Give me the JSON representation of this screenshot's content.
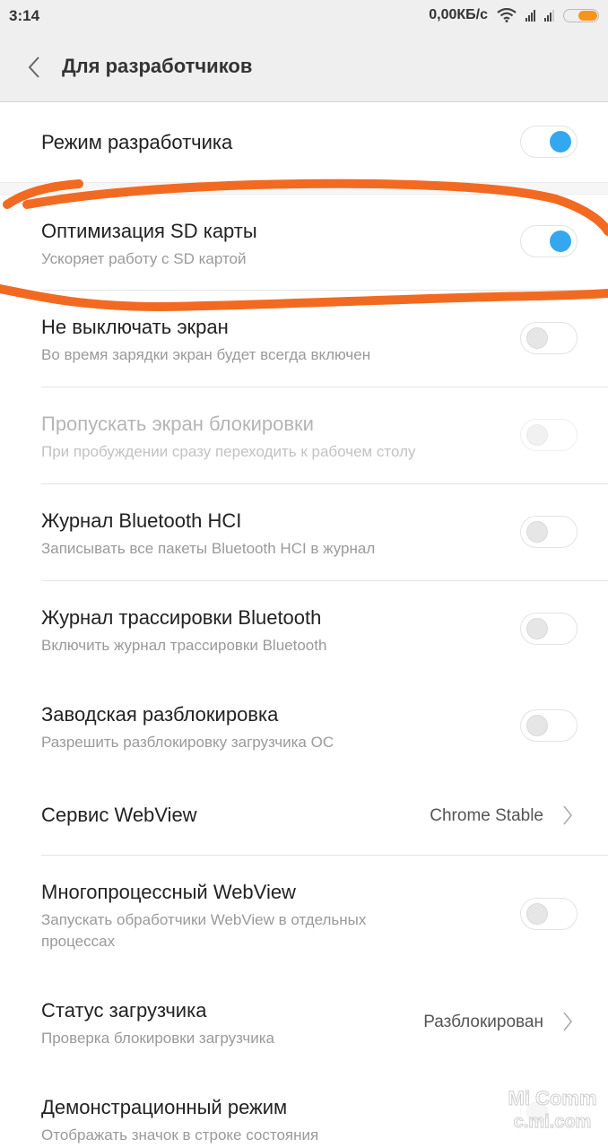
{
  "status_bar": {
    "time": "3:14",
    "net_speed": "0,00КБ/с",
    "wifi_icon": "wifi-icon",
    "signal_icons": [
      "signal-sim1-icon",
      "signal-sim2-icon"
    ],
    "battery_percent": 60,
    "battery_color": "#f7941d"
  },
  "header": {
    "back_icon": "chevron-left-icon",
    "title": "Для разработчиков"
  },
  "items": [
    {
      "title": "Режим разработчика",
      "subtitle": "",
      "control": "toggle",
      "on": true
    },
    {
      "title": "Оптимизация SD карты",
      "subtitle": "Ускоряет работу с SD картой",
      "control": "toggle",
      "on": true
    },
    {
      "title": "Не выключать экран",
      "subtitle": "Во время зарядки экран будет всегда включен",
      "control": "toggle",
      "on": false
    },
    {
      "title": "Пропускать экран блокировки",
      "subtitle": "При пробуждении сразу переходить к рабочем столу",
      "control": "toggle",
      "on": false,
      "disabled": true
    },
    {
      "title": "Журнал Bluetooth HCI",
      "subtitle": "Записывать все пакеты Bluetooth HCI в журнал",
      "control": "toggle",
      "on": false
    },
    {
      "title": "Журнал трассировки Bluetooth",
      "subtitle": "Включить журнал трассировки Bluetooth",
      "control": "toggle",
      "on": false
    },
    {
      "title": "Заводская разблокировка",
      "subtitle": "Разрешить разблокировку загрузчика ОС",
      "control": "toggle",
      "on": false
    },
    {
      "title": "Сервис WebView",
      "subtitle": "",
      "control": "link",
      "value": "Chrome Stable"
    },
    {
      "title": "Многопроцессный WebView",
      "subtitle_line1": "Запускать обработчики WebView в отдельных",
      "subtitle_line2": "процессах",
      "control": "toggle",
      "on": false
    },
    {
      "title": "Статус загрузчика",
      "subtitle": "Проверка блокировки загрузчика",
      "control": "link",
      "value": "Разблокирован"
    },
    {
      "title": "Демонстрационный режим",
      "subtitle": "Отображать значок в строке состояния",
      "control": "toggle",
      "on": false
    }
  ],
  "watermark": {
    "line1": "Mi Comm",
    "line2": "c.mi.com"
  },
  "colors": {
    "accent": "#34a7f1",
    "annotation": "#f26a21"
  }
}
